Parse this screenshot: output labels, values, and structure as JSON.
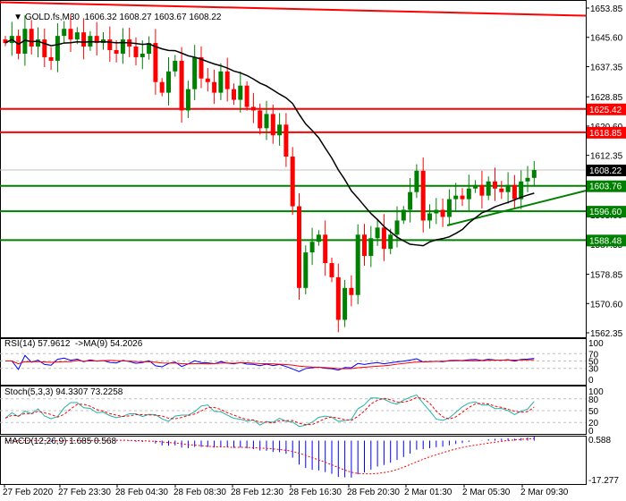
{
  "header": {
    "symbol": "GOLD.fs,M30",
    "open": "1606.32",
    "high": "1608.27",
    "low": "1603.67",
    "close": "1608.22"
  },
  "indicators": {
    "rsi_label": "RSI(14) 57.9612  ->MA(9) 54.2026",
    "stoch_label": "Stoch(5,3,3) 94.3307 73.2258",
    "macd_label": "MACD(12,26,9) 1.685 0.568"
  },
  "colors": {
    "bull": "#008000",
    "bear": "#ff0000",
    "ma": "#000000",
    "resistance": "#ff0000",
    "support": "#008000"
  },
  "chart_data": {
    "type": "candlestick",
    "title": "GOLD.fs,M30",
    "ylim": [
      1562.35,
      1653.85
    ],
    "y_ticks": [
      "1653.85",
      "1645.60",
      "1637.35",
      "1628.85",
      "1620.60",
      "1612.35",
      "1595.60",
      "1587.35",
      "1578.85",
      "1570.60",
      "1562.35"
    ],
    "x_ticks": [
      "27 Feb 2020",
      "27 Feb 23:30",
      "28 Feb 04:30",
      "28 Feb 08:30",
      "28 Feb 12:30",
      "28 Feb 16:30",
      "28 Feb 20:30",
      "2 Mar 01:30",
      "2 Mar 05:30",
      "2 Mar 09:30"
    ],
    "closes": [
      1644,
      1646,
      1641,
      1648,
      1643,
      1645,
      1640,
      1639,
      1646,
      1648,
      1645,
      1647,
      1643,
      1646,
      1644,
      1645,
      1642,
      1641,
      1645,
      1643,
      1640,
      1641,
      1644,
      1633,
      1630,
      1636,
      1639,
      1625,
      1631,
      1640,
      1634,
      1633,
      1630,
      1636,
      1631,
      1628,
      1632,
      1626,
      1625,
      1620,
      1624,
      1618,
      1621,
      1612,
      1598,
      1575,
      1585,
      1588,
      1590,
      1582,
      1578,
      1566,
      1575,
      1573,
      1590,
      1584,
      1589,
      1592,
      1586,
      1590,
      1594,
      1597,
      1602,
      1608,
      1594,
      1596,
      1597,
      1595,
      1600,
      1601,
      1600,
      1603,
      1604,
      1601,
      1605,
      1603,
      1602,
      1604,
      1600,
      1605,
      1606,
      1608.22
    ],
    "moving_average_period": 20,
    "levels": [
      {
        "label": "1625.42",
        "value": 1625.42,
        "color": "#ff0000"
      },
      {
        "label": "1618.85",
        "value": 1618.85,
        "color": "#ff0000"
      },
      {
        "label": "1608.22",
        "value": 1608.22,
        "color": "#000000"
      },
      {
        "label": "1603.76",
        "value": 1603.76,
        "color": "#008000"
      },
      {
        "label": "1596.60",
        "value": 1596.6,
        "color": "#008000"
      },
      {
        "label": "1588.48",
        "value": 1588.48,
        "color": "#008000"
      }
    ],
    "resistance_trendline": [
      1655.5,
      1651.7
    ],
    "support_trendline": [
      1592.6,
      1602.4
    ],
    "rsi_ticks": [
      "100",
      "70",
      "50",
      "30",
      "0"
    ],
    "stoch_ticks": [
      "100",
      "80",
      "50",
      "20",
      "0"
    ],
    "macd_ticks": [
      "0.588",
      "-17.277"
    ]
  }
}
